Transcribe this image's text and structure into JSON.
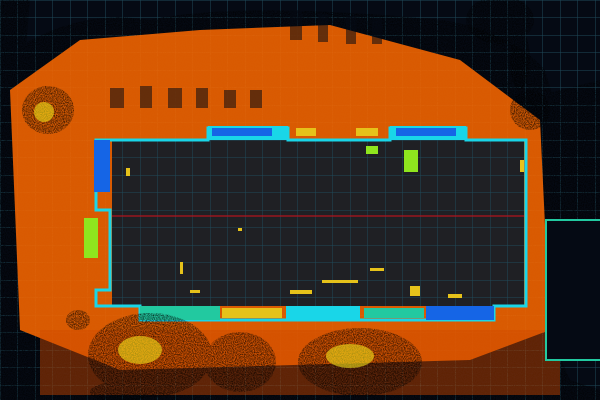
{
  "scene": {
    "description_type": "lidar-point-cloud-top-view",
    "colors": {
      "background": "#050a14",
      "grid": "#1f4a5a",
      "ground": "#ff6a00",
      "ground_dark": "#c94400",
      "wall_cyan": "#19d6e8",
      "wall_blue": "#1565e6",
      "wall_teal": "#22c9a0",
      "vegetation_green": "#8fe61e",
      "vegetation_yellow": "#f2e11a",
      "interior_speck": "#e6c21a",
      "section_line": "#b0141c",
      "outline_cyan": "#2ed8e0"
    }
  }
}
